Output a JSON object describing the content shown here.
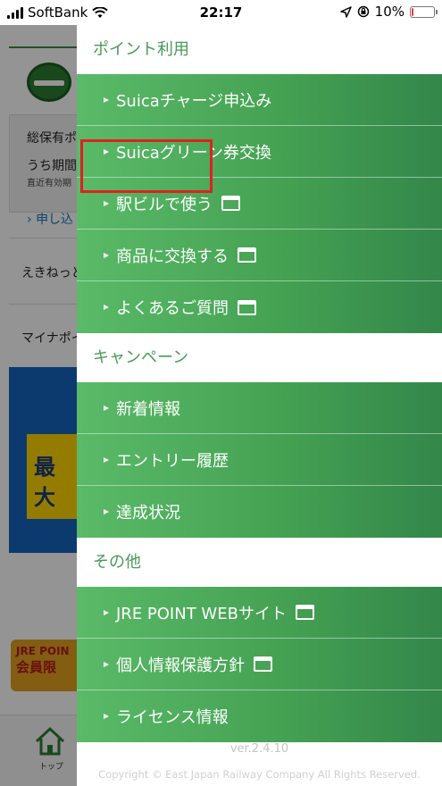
{
  "status_bar": {
    "carrier": "SoftBank",
    "time": "22:17",
    "battery": "10%",
    "battery_level": 0.1,
    "battery_color": "#e53935"
  },
  "background_page": {
    "box_line1": "総保有ポ",
    "box_line2": "うち期間",
    "box_line3": "直近有効期",
    "link": "申し込",
    "row1": "えきねっと",
    "row2": "マイナポイ",
    "banner_text": "最大",
    "card_text1": "JRE POIN",
    "card_text2": "会員限",
    "tab_home": "トップ"
  },
  "drawer": {
    "sections": [
      {
        "header": "ポイント利用",
        "items": [
          {
            "label": "Suicaチャージ申込み",
            "external": false
          },
          {
            "label": "Suicaグリーン券交換",
            "external": false
          },
          {
            "label": "駅ビルで使う",
            "external": true
          },
          {
            "label": "商品に交換する",
            "external": true
          },
          {
            "label": "よくあるご質問",
            "external": true
          }
        ]
      },
      {
        "header": "キャンペーン",
        "items": [
          {
            "label": "新着情報",
            "external": false
          },
          {
            "label": "エントリー履歴",
            "external": false
          },
          {
            "label": "達成状況",
            "external": false
          }
        ]
      },
      {
        "header": "その他",
        "items": [
          {
            "label": "JRE POINT WEBサイト",
            "external": true
          },
          {
            "label": "個人情報保護方針",
            "external": true
          },
          {
            "label": "ライセンス情報",
            "external": false
          }
        ]
      }
    ],
    "version": "ver.2.4.10",
    "copyright": "Copyright © East Japan Railway Company All Rights Reserved."
  },
  "colors": {
    "accent_green": "#4a9a58",
    "highlight_red": "#e02020"
  }
}
